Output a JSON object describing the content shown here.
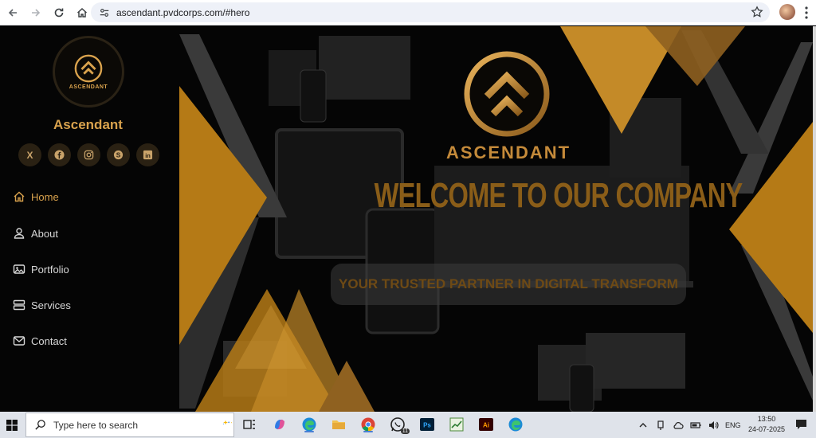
{
  "browser": {
    "url": "ascendant.pvdcorps.com/#hero"
  },
  "sidebar": {
    "logo_text": "ASCENDANT",
    "brand_name": "Ascendant",
    "socials": [
      {
        "name": "x",
        "glyph": "X"
      },
      {
        "name": "facebook",
        "glyph": "f"
      },
      {
        "name": "instagram",
        "glyph": ""
      },
      {
        "name": "skype",
        "glyph": "S"
      },
      {
        "name": "linkedin",
        "glyph": "in"
      }
    ],
    "nav": [
      {
        "label": "Home",
        "icon": "home-icon",
        "active": true
      },
      {
        "label": "About",
        "icon": "person-icon",
        "active": false
      },
      {
        "label": "Portfolio",
        "icon": "images-icon",
        "active": false
      },
      {
        "label": "Services",
        "icon": "server-icon",
        "active": false
      },
      {
        "label": "Contact",
        "icon": "envelope-icon",
        "active": false
      }
    ]
  },
  "hero": {
    "brand": "ASCENDANT",
    "title": "WELCOME TO OUR COMPANY",
    "tagline": "YOUR TRUSTED PARTNER IN DIGITAL TRANSFORM"
  },
  "taskbar": {
    "search_placeholder": "Type here to search",
    "whatsapp_badge": "11",
    "language": "ENG",
    "time": "13:50",
    "date": "24-07-2025"
  },
  "colors": {
    "accent_gold": "#d9a24d",
    "dark_gold": "#8a5d18",
    "background": "#050505"
  }
}
